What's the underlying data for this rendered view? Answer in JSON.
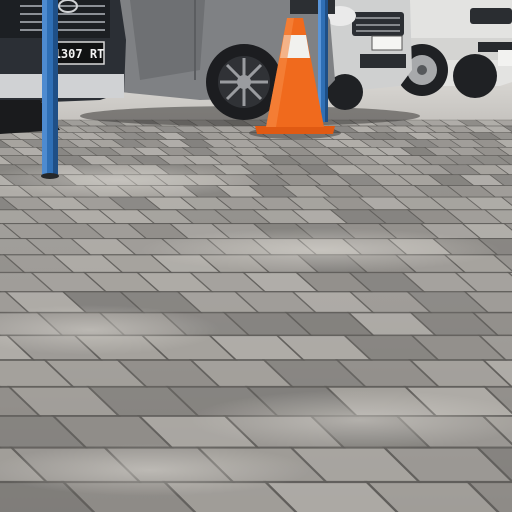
{
  "scene": {
    "colors": {
      "pavement_light": "#b5b2ad",
      "pavement_mid": "#9e9b97",
      "pavement_dark": "#7c7a77",
      "joint": "#5e5c59",
      "car_dark": "#2b2f35",
      "car_grey": "#7d7f82",
      "car_silver": "#cfd0d0",
      "car_white": "#e2e2e0",
      "cone_orange": "#f06a1d",
      "cone_stripe": "#f1f1ee",
      "pole_blue": "#2f6fb5"
    },
    "objects": {
      "cars": [
        {
          "name": "dark-suv",
          "plate_text": "1307 RT"
        },
        {
          "name": "grey-sedan",
          "plate_text": ""
        },
        {
          "name": "silver-mpv",
          "plate_text": ""
        },
        {
          "name": "white-mpv",
          "plate_text": ""
        }
      ],
      "cone": {
        "stripe_count": 1
      },
      "poles": {
        "count": 2
      }
    }
  }
}
